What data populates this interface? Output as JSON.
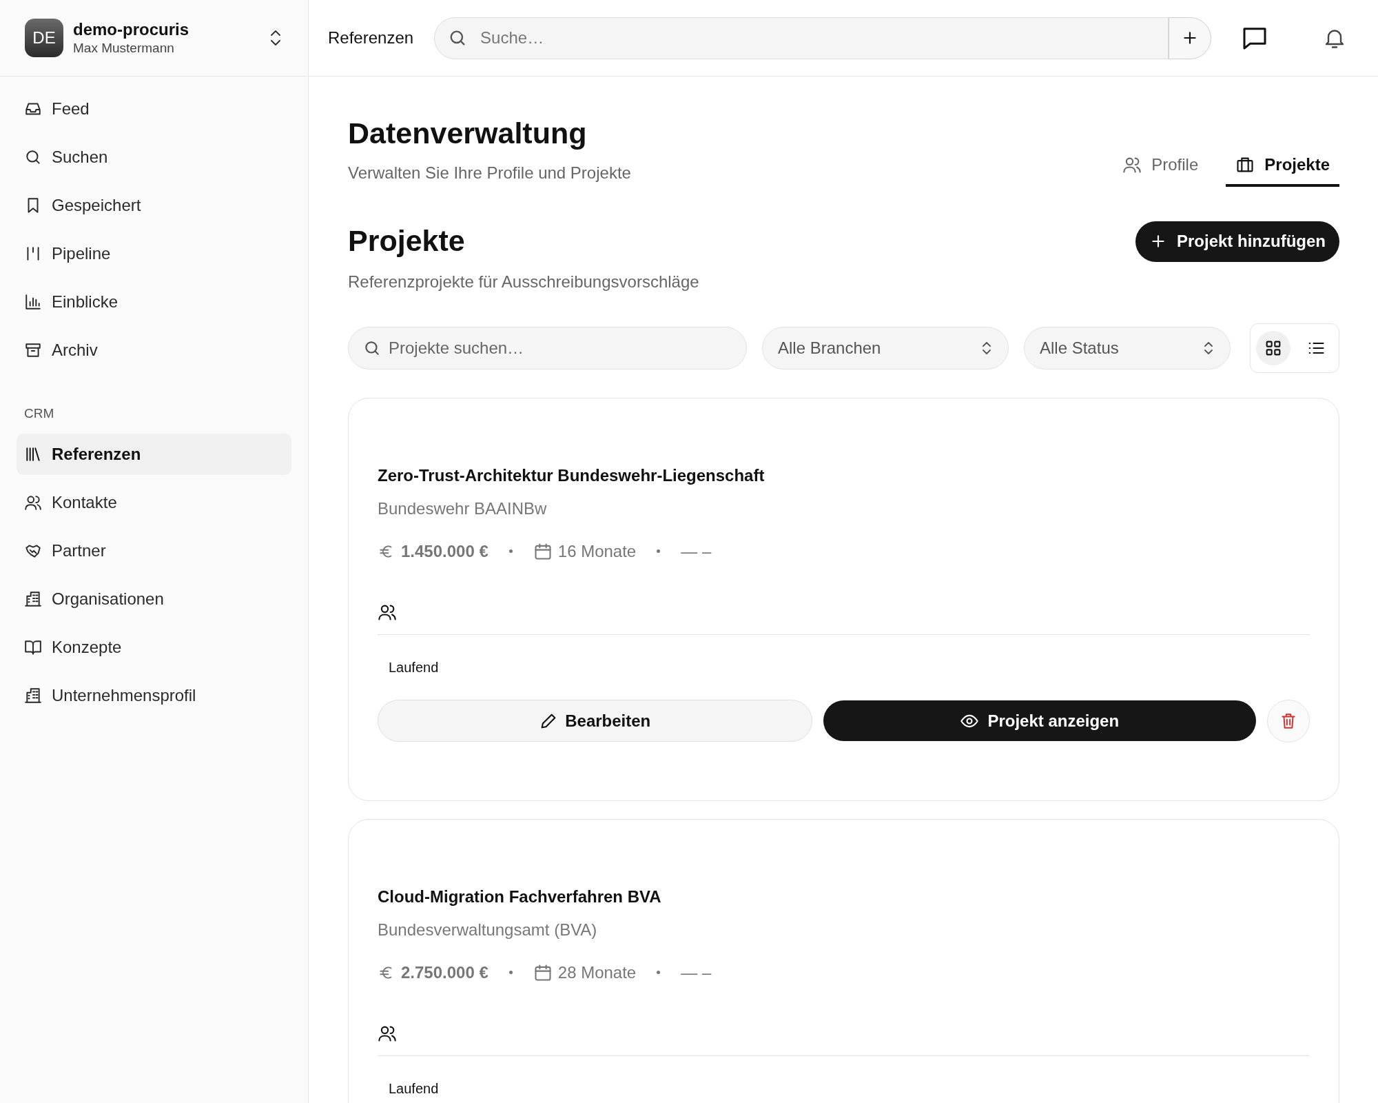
{
  "workspace": {
    "initials": "DE",
    "name": "demo-procuris",
    "user": "Max Mustermann"
  },
  "sidebar": {
    "main_items": [
      {
        "label": "Feed",
        "kind": "inbox",
        "selected": false
      },
      {
        "label": "Suchen",
        "kind": "search",
        "selected": false
      },
      {
        "label": "Gespeichert",
        "kind": "bookmark",
        "selected": false
      },
      {
        "label": "Pipeline",
        "kind": "pipeline",
        "selected": false
      },
      {
        "label": "Einblicke",
        "kind": "chart",
        "selected": false
      },
      {
        "label": "Archiv",
        "kind": "archive",
        "selected": false
      }
    ],
    "section_heading": "CRM",
    "crm_items": [
      {
        "label": "Referenzen",
        "kind": "library",
        "selected": true
      },
      {
        "label": "Kontakte",
        "kind": "users",
        "selected": false
      },
      {
        "label": "Partner",
        "kind": "handshake",
        "selected": false
      },
      {
        "label": "Organisationen",
        "kind": "building",
        "selected": false
      },
      {
        "label": "Konzepte",
        "kind": "book",
        "selected": false
      },
      {
        "label": "Unternehmensprofil",
        "kind": "building",
        "selected": false
      }
    ]
  },
  "topbar": {
    "breadcrumb": "Referenzen",
    "search_placeholder": "Suche…"
  },
  "page": {
    "title": "Datenverwaltung",
    "subtitle": "Verwalten Sie Ihre Profile und Projekte"
  },
  "tabs": [
    {
      "label": "Profile",
      "kind": "users",
      "selected": false
    },
    {
      "label": "Projekte",
      "kind": "briefcase",
      "selected": true
    }
  ],
  "section": {
    "title": "Projekte",
    "subtitle": "Referenzprojekte für Ausschreibungsvorschläge",
    "add_button": "Projekt hinzufügen"
  },
  "filters": {
    "search_placeholder": "Projekte suchen…",
    "branch": "Alle Branchen",
    "status": "Alle Status"
  },
  "view_modes": [
    {
      "kind": "grid",
      "selected": true
    },
    {
      "kind": "list",
      "selected": false
    }
  ],
  "projects": [
    {
      "title": "Zero-Trust-Architektur Bundeswehr-Liegenschaft",
      "client": "Bundeswehr BAAINBw",
      "budget": "1.450.000 €",
      "duration": "16 Monate",
      "dates": "— –",
      "status": "Laufend",
      "edit_button": "Bearbeiten",
      "view_button": "Projekt anzeigen"
    },
    {
      "title": "Cloud-Migration Fachverfahren BVA",
      "client": "Bundesverwaltungsamt (BVA)",
      "budget": "2.750.000 €",
      "duration": "28 Monate",
      "dates": "— –",
      "status": "Laufend"
    }
  ]
}
